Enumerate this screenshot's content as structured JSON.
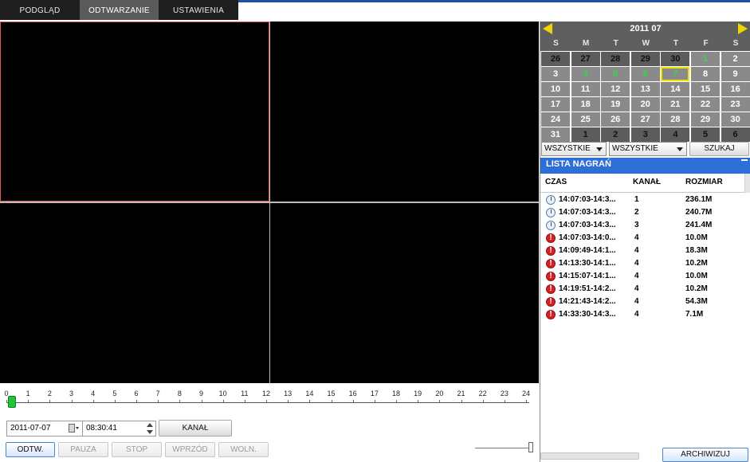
{
  "tabs": [
    {
      "label": "PODGLĄD",
      "active": false
    },
    {
      "label": "ODTWARZANIE",
      "active": true
    },
    {
      "label": "USTAWIENIA",
      "active": false
    }
  ],
  "timeline": {
    "hours": [
      "0",
      "1",
      "2",
      "3",
      "4",
      "5",
      "6",
      "7",
      "8",
      "9",
      "10",
      "11",
      "12",
      "13",
      "14",
      "15",
      "16",
      "17",
      "18",
      "19",
      "20",
      "21",
      "22",
      "23",
      "24"
    ],
    "position_hours": 0.1
  },
  "playback": {
    "date_value": "2011-07-07",
    "time_value": "08:30:41",
    "channel_button": "KANAŁ",
    "buttons": {
      "play": "ODTW.",
      "pause": "PAUZA",
      "stop": "STOP",
      "forward": "WPRZÓD",
      "slow": "WOLN."
    },
    "volume_level": 1.0
  },
  "calendar": {
    "title": "2011 07",
    "weekdays": [
      "S",
      "M",
      "T",
      "W",
      "T",
      "F",
      "S"
    ],
    "selected_day": "7",
    "weeks": [
      [
        {
          "d": "26",
          "s": "o"
        },
        {
          "d": "27",
          "s": "o"
        },
        {
          "d": "28",
          "s": "o"
        },
        {
          "d": "29",
          "s": "o"
        },
        {
          "d": "30",
          "s": "o"
        },
        {
          "d": "1",
          "s": "r"
        },
        {
          "d": "2",
          "s": "n"
        }
      ],
      [
        {
          "d": "3",
          "s": "n"
        },
        {
          "d": "4",
          "s": "r"
        },
        {
          "d": "5",
          "s": "r"
        },
        {
          "d": "6",
          "s": "r"
        },
        {
          "d": "7",
          "s": "rs"
        },
        {
          "d": "8",
          "s": "n"
        },
        {
          "d": "9",
          "s": "n"
        }
      ],
      [
        {
          "d": "10",
          "s": "n"
        },
        {
          "d": "11",
          "s": "n"
        },
        {
          "d": "12",
          "s": "n"
        },
        {
          "d": "13",
          "s": "n"
        },
        {
          "d": "14",
          "s": "n"
        },
        {
          "d": "15",
          "s": "n"
        },
        {
          "d": "16",
          "s": "n"
        }
      ],
      [
        {
          "d": "17",
          "s": "n"
        },
        {
          "d": "18",
          "s": "n"
        },
        {
          "d": "19",
          "s": "n"
        },
        {
          "d": "20",
          "s": "n"
        },
        {
          "d": "21",
          "s": "n"
        },
        {
          "d": "22",
          "s": "n"
        },
        {
          "d": "23",
          "s": "n"
        }
      ],
      [
        {
          "d": "24",
          "s": "n"
        },
        {
          "d": "25",
          "s": "n"
        },
        {
          "d": "26",
          "s": "n"
        },
        {
          "d": "27",
          "s": "n"
        },
        {
          "d": "28",
          "s": "n"
        },
        {
          "d": "29",
          "s": "n"
        },
        {
          "d": "30",
          "s": "n"
        }
      ],
      [
        {
          "d": "31",
          "s": "n"
        },
        {
          "d": "1",
          "s": "o"
        },
        {
          "d": "2",
          "s": "o"
        },
        {
          "d": "3",
          "s": "o"
        },
        {
          "d": "4",
          "s": "o"
        },
        {
          "d": "5",
          "s": "o"
        },
        {
          "d": "6",
          "s": "o"
        }
      ]
    ]
  },
  "filters": {
    "type_select": "WSZYSTKIE",
    "channel_select": "WSZYSTKIE",
    "search_button": "SZUKAJ"
  },
  "recordings": {
    "title": "LISTA NAGRAŃ",
    "columns": {
      "time": "CZAS",
      "channel": "KANAŁ",
      "size": "ROZMIAR"
    },
    "rows": [
      {
        "icon": "clock-icon",
        "time": "14:07:03-14:3...",
        "channel": "1",
        "size": "236.1M"
      },
      {
        "icon": "clock-icon",
        "time": "14:07:03-14:3...",
        "channel": "2",
        "size": "240.7M"
      },
      {
        "icon": "clock-icon",
        "time": "14:07:03-14:3...",
        "channel": "3",
        "size": "241.4M"
      },
      {
        "icon": "alert-icon",
        "time": "14:07:03-14:0...",
        "channel": "4",
        "size": "10.0M"
      },
      {
        "icon": "alert-icon",
        "time": "14:09:49-14:1...",
        "channel": "4",
        "size": "18.3M"
      },
      {
        "icon": "alert-icon",
        "time": "14:13:30-14:1...",
        "channel": "4",
        "size": "10.2M"
      },
      {
        "icon": "alert-icon",
        "time": "14:15:07-14:1...",
        "channel": "4",
        "size": "10.0M"
      },
      {
        "icon": "alert-icon",
        "time": "14:19:51-14:2...",
        "channel": "4",
        "size": "10.2M"
      },
      {
        "icon": "alert-icon",
        "time": "14:21:43-14:2...",
        "channel": "4",
        "size": "54.3M"
      },
      {
        "icon": "alert-icon",
        "time": "14:33:30-14:3...",
        "channel": "4",
        "size": "7.1M"
      }
    ],
    "archive_button": "ARCHIWIZUJ"
  },
  "colors": {
    "accent_blue": "#2d6fd6",
    "selected_cell_border": "#e05555",
    "recorded_day": "#37d64b",
    "calendar_day_bg": "#8a8a8a",
    "calendar_day_bg_other": "#5c5c5c",
    "calendar_selected_border": "#f2e200"
  }
}
